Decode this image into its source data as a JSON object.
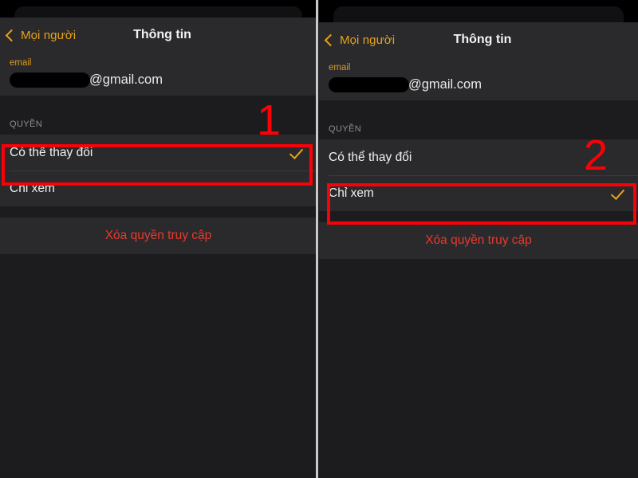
{
  "meta": {
    "panel_count": 2,
    "accent_color": "#e8a317",
    "annotation_color": "#fb0007",
    "danger_color": "#e8392e",
    "row_background": "#2a2a2c",
    "page_background": "#1c1c1e"
  },
  "panels": [
    {
      "id": "step-1",
      "nav": {
        "back_icon": "chevron-left-icon",
        "back_label": "Mọi người",
        "title": "Thông tin"
      },
      "email": {
        "label": "email",
        "redacted_placeholder": "",
        "domain": "@gmail.com"
      },
      "section": {
        "header": "QUYỀN",
        "rows": [
          {
            "label": "Có thể thay đổi",
            "checked": true
          },
          {
            "label": "Chỉ xem",
            "checked": false
          }
        ]
      },
      "danger": {
        "label": "Xóa quyền truy cập"
      },
      "annotation": {
        "number": "1",
        "highlights_row": "Có thể thay đổi"
      }
    },
    {
      "id": "step-2",
      "nav": {
        "back_icon": "chevron-left-icon",
        "back_label": "Mọi người",
        "title": "Thông tin"
      },
      "email": {
        "label": "email",
        "redacted_placeholder": "",
        "domain": "@gmail.com"
      },
      "section": {
        "header": "QUYỀN",
        "rows": [
          {
            "label": "Có thể thay đổi",
            "checked": false
          },
          {
            "label": "Chỉ xem",
            "checked": true
          }
        ]
      },
      "danger": {
        "label": "Xóa quyền truy cập"
      },
      "annotation": {
        "number": "2",
        "highlights_row": "Chỉ xem"
      }
    }
  ]
}
